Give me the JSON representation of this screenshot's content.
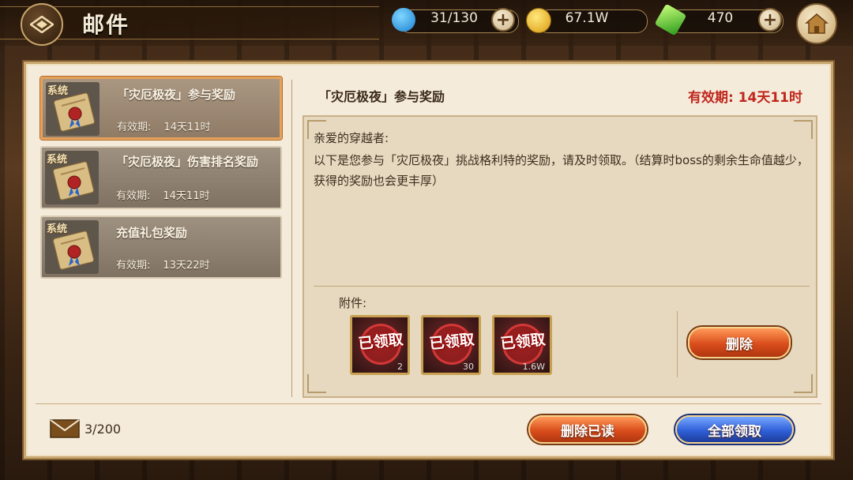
{
  "header": {
    "title": "邮件",
    "resources": [
      {
        "icon": "fish-currency-icon",
        "value": "31/130"
      },
      {
        "icon": "gold-coin-icon",
        "value": "67.1W"
      },
      {
        "icon": "green-gem-icon",
        "value": "470"
      }
    ]
  },
  "mail_list": [
    {
      "tag": "系统",
      "name": "「灾厄极夜」参与奖励",
      "expire_label": "有效期:",
      "expire_value": "14天11时",
      "selected": true
    },
    {
      "tag": "系统",
      "name": "「灾厄极夜」伤害排名奖励",
      "expire_label": "有效期:",
      "expire_value": "14天11时",
      "selected": false
    },
    {
      "tag": "系统",
      "name": "充值礼包奖励",
      "expire_label": "有效期:",
      "expire_value": "13天22时",
      "selected": false
    }
  ],
  "detail": {
    "title": "「灾厄极夜」参与奖励",
    "expire": "有效期: 14天11时",
    "greeting": "亲爱的穿越者:",
    "body": "以下是您参与「灾厄极夜」挑战格利特的奖励，请及时领取。（结算时boss的剩余生命值越少，获得的奖励也会更丰厚）",
    "attachment_label": "附件:",
    "attachments": [
      {
        "status": "已领取",
        "qty": "2"
      },
      {
        "status": "已领取",
        "qty": "30"
      },
      {
        "status": "已领取",
        "qty": "1.6W"
      }
    ],
    "delete_button": "删除"
  },
  "footer": {
    "mail_count": "3/200",
    "delete_read_button": "删除已读",
    "claim_all_button": "全部领取"
  },
  "colors": {
    "accent_red": "#c0271d",
    "panel_bg": "#f4ebdb"
  }
}
